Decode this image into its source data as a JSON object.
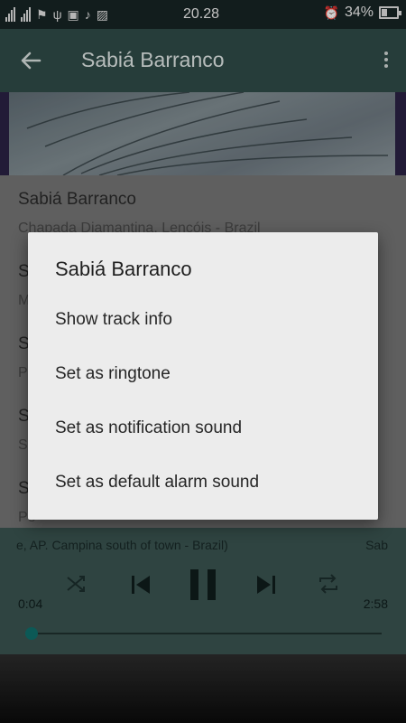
{
  "status_bar": {
    "time": "20.28",
    "battery": "34%"
  },
  "app_bar": {
    "title": "Sabiá Barranco"
  },
  "tracks": [
    {
      "title": "Sabiá Barranco",
      "subtitle": "Chapada Diamantina, Lencóis - Brazil"
    },
    {
      "title": "S",
      "subtitle": "M"
    },
    {
      "title": "S",
      "subtitle": "P"
    },
    {
      "title": "S",
      "subtitle": "S"
    },
    {
      "title": "S",
      "subtitle": "Pe"
    }
  ],
  "player": {
    "now_playing_left": "e, AP. Campina south of town - Brazil)",
    "now_playing_right": "Sab",
    "elapsed": "0:04",
    "duration": "2:58",
    "progress": 0.02
  },
  "dialog": {
    "title": "Sabiá Barranco",
    "options": [
      "Show track info",
      "Set as ringtone",
      "Set as notification sound",
      "Set as default alarm sound"
    ]
  },
  "icons": [
    "back-arrow-icon",
    "more-vert-icon",
    "shuffle-icon",
    "previous-icon",
    "pause-icon",
    "next-icon",
    "repeat-icon",
    "alarm-icon",
    "battery-icon"
  ],
  "colors": {
    "app_bar": "#2f4b47",
    "player": "#3a5350",
    "accent": "#0f6d6a",
    "dialog": "#ececec"
  }
}
